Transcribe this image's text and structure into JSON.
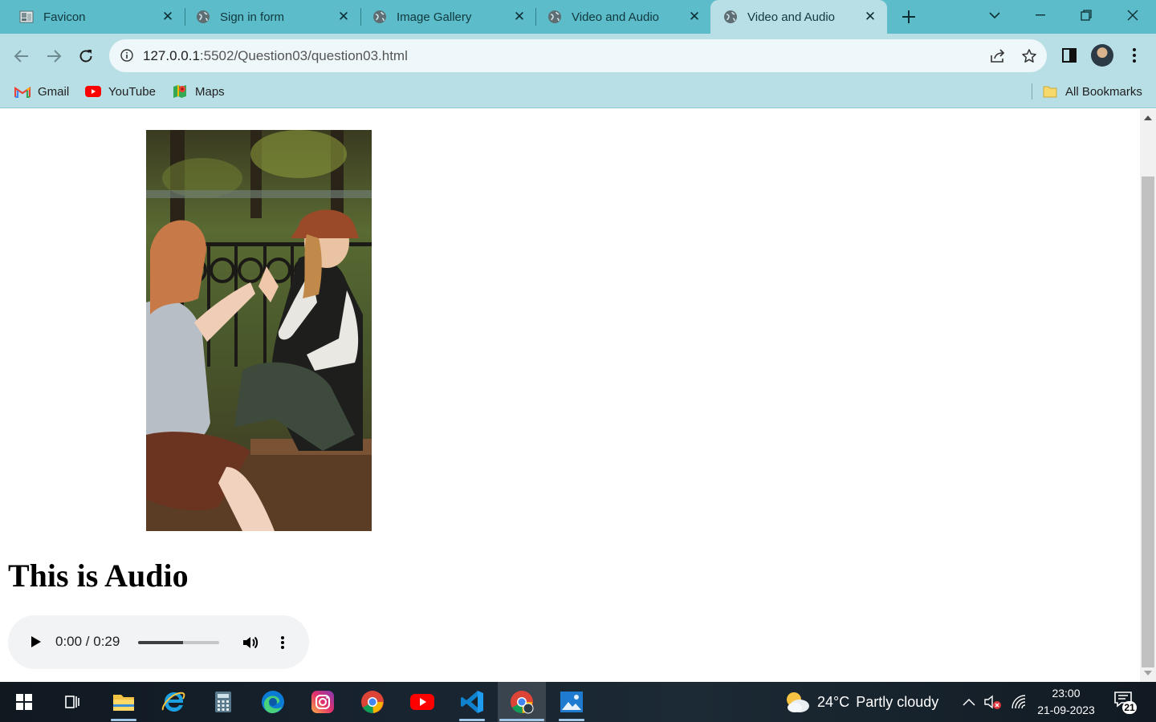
{
  "browser": {
    "tabs": [
      {
        "title": "Favicon",
        "icon": "favicon-image-icon",
        "active": false
      },
      {
        "title": "Sign in form",
        "icon": "globe-icon",
        "active": false
      },
      {
        "title": "Image Gallery",
        "icon": "globe-icon",
        "active": false
      },
      {
        "title": "Video and Audio",
        "icon": "globe-icon",
        "active": false
      },
      {
        "title": "Video and Audio",
        "icon": "globe-icon",
        "active": true
      }
    ],
    "url_host": "127.0.0.1",
    "url_path": ":5502/Question03/question03.html",
    "bookmarks": [
      {
        "label": "Gmail",
        "icon": "gmail-icon"
      },
      {
        "label": "YouTube",
        "icon": "youtube-icon"
      },
      {
        "label": "Maps",
        "icon": "maps-icon"
      }
    ],
    "all_bookmarks_label": "All Bookmarks",
    "colors": {
      "tabstrip": "#5cbcc9",
      "toolbar": "#b9dfe6",
      "omnibox": "#eef7f9"
    }
  },
  "page": {
    "heading": "This is Audio",
    "audio": {
      "time": "0:00 / 0:29",
      "volume_fraction": 0.55
    }
  },
  "taskbar": {
    "apps": [
      "start",
      "task-view",
      "file-explorer",
      "internet-explorer",
      "calculator",
      "edge",
      "instagram",
      "chrome",
      "youtube",
      "vscode",
      "chrome-profile",
      "photos"
    ],
    "weather": {
      "temp": "24°C",
      "condition": "Partly cloudy"
    },
    "time": "23:00",
    "date": "21-09-2023",
    "notification_count": "21"
  }
}
